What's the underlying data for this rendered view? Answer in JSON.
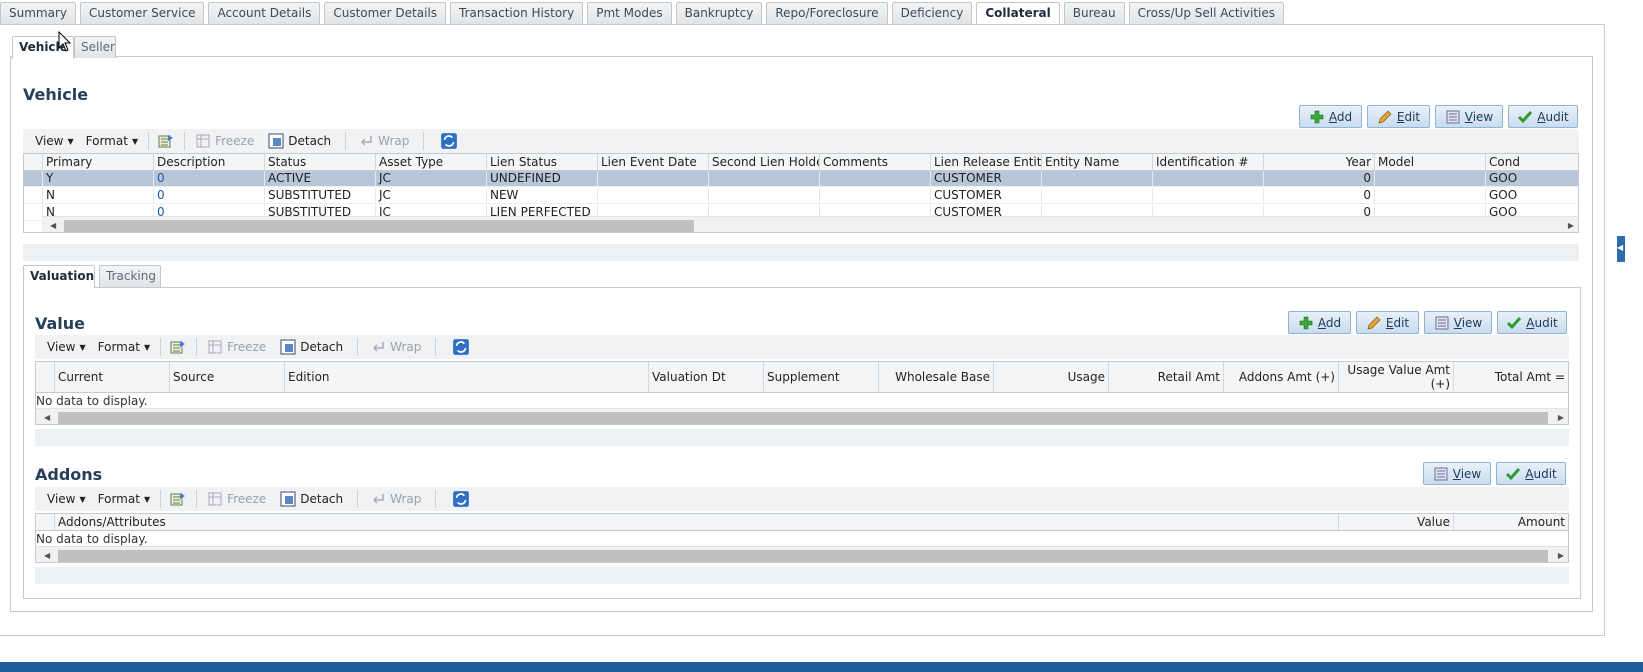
{
  "top_tabs": [
    "Summary",
    "Customer Service",
    "Account Details",
    "Customer Details",
    "Transaction History",
    "Pmt Modes",
    "Bankruptcy",
    "Repo/Foreclosure",
    "Deficiency",
    "Collateral",
    "Bureau",
    "Cross/Up Sell Activities"
  ],
  "active_top_tab": "Collateral",
  "sub_tabs": [
    "Vehicle",
    "Seller"
  ],
  "vehicle": {
    "title": "Vehicle",
    "buttons": {
      "add": "Add",
      "edit": "Edit",
      "view": "View",
      "audit": "Audit"
    },
    "toolbar": {
      "view": "View",
      "format": "Format",
      "freeze": "Freeze",
      "detach": "Detach",
      "wrap": "Wrap"
    },
    "columns": [
      "Primary",
      "Description",
      "Status",
      "Asset Type",
      "Lien Status",
      "Lien Event Date",
      "Second Lien Holder",
      "Comments",
      "Lien Release Entity",
      "Entity Name",
      "Identification #",
      "Year",
      "Model",
      "Cond"
    ],
    "rows": [
      {
        "primary": "Y",
        "description": "0",
        "status": "ACTIVE",
        "asset_type": "JC",
        "lien_status": "UNDEFINED",
        "lien_event_date": "",
        "second_lien_holder": "",
        "comments": "",
        "lien_release_entity": "CUSTOMER",
        "entity_name": "",
        "identification": "",
        "year": "0",
        "model": "",
        "cond": "GOO"
      },
      {
        "primary": "N",
        "description": "0",
        "status": "SUBSTITUTED",
        "asset_type": "JC",
        "lien_status": "NEW",
        "lien_event_date": "",
        "second_lien_holder": "",
        "comments": "",
        "lien_release_entity": "CUSTOMER",
        "entity_name": "",
        "identification": "",
        "year": "0",
        "model": "",
        "cond": "GOO"
      },
      {
        "primary": "N",
        "description": "0",
        "status": "SUBSTITUTED",
        "asset_type": "JC",
        "lien_status": "LIEN PERFECTED",
        "lien_event_date": "",
        "second_lien_holder": "",
        "comments": "",
        "lien_release_entity": "CUSTOMER",
        "entity_name": "",
        "identification": "",
        "year": "0",
        "model": "",
        "cond": "GOO"
      }
    ]
  },
  "inner_tabs": [
    "Valuation",
    "Tracking"
  ],
  "value": {
    "title": "Value",
    "buttons": {
      "add": "Add",
      "edit": "Edit",
      "view": "View",
      "audit": "Audit"
    },
    "toolbar": {
      "view": "View",
      "format": "Format",
      "freeze": "Freeze",
      "detach": "Detach",
      "wrap": "Wrap"
    },
    "columns": [
      "Current",
      "Source",
      "Edition",
      "Valuation Dt",
      "Supplement",
      "Wholesale Base",
      "Usage",
      "Retail Amt",
      "Addons Amt (+)",
      "Usage Value Amt (+)",
      "Total Amt ="
    ],
    "empty_text": "No data to display."
  },
  "addons": {
    "title": "Addons",
    "buttons": {
      "view": "View",
      "audit": "Audit"
    },
    "toolbar": {
      "view": "View",
      "format": "Format",
      "freeze": "Freeze",
      "detach": "Detach",
      "wrap": "Wrap"
    },
    "columns": [
      "Addons/Attributes",
      "Value",
      "Amount"
    ],
    "empty_text": "No data to display."
  },
  "colors": {
    "accent": "#1f5c9a",
    "bottom_bar": "#1f5c9a",
    "selected_row": "#b7c6d9"
  }
}
